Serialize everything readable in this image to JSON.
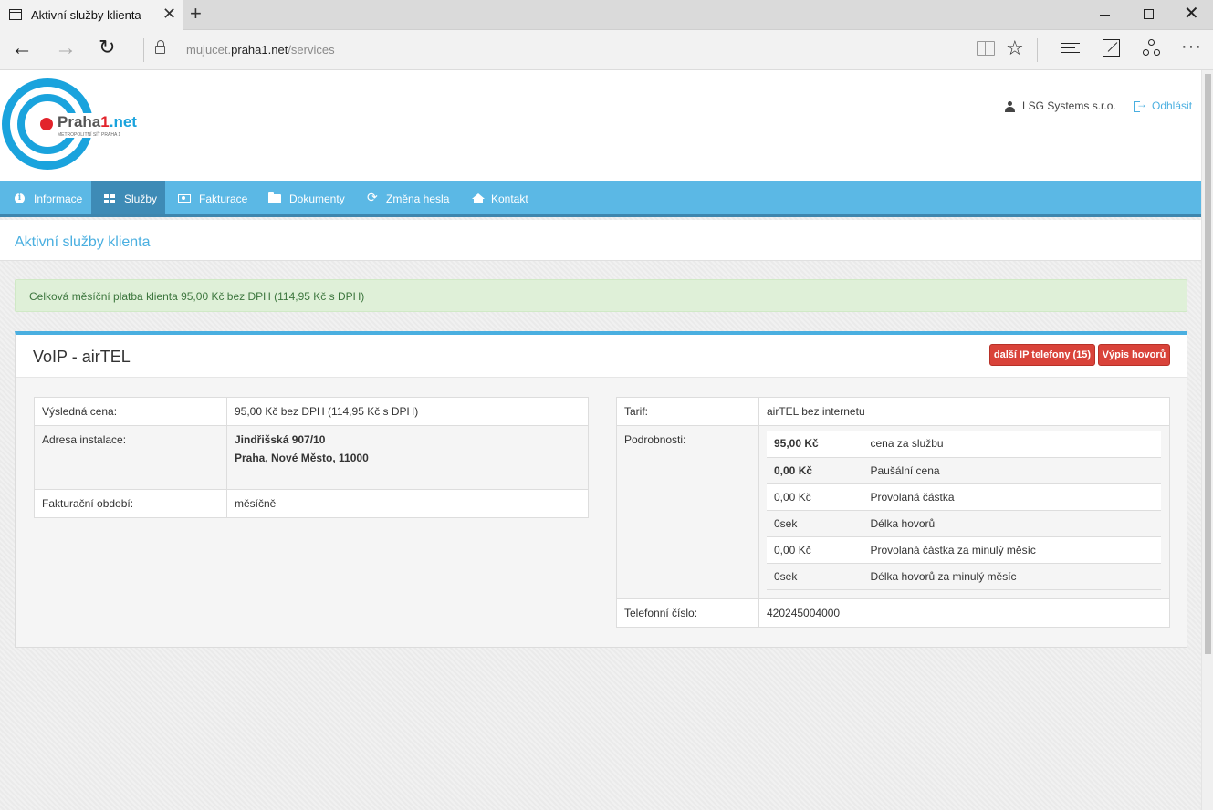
{
  "browser": {
    "tab_title": "Aktivní služby klienta",
    "url_prefix": "mujucet.",
    "url_domain": "praha1.net",
    "url_path": "/services"
  },
  "header": {
    "logo_text_a": "Praha",
    "logo_text_b": "1",
    "logo_text_c": ".net",
    "logo_subtitle": "METROPOLITNÍ SÍŤ PRAHA 1",
    "user_name": "LSG Systems s.r.o.",
    "logout_label": "Odhlásit"
  },
  "nav": {
    "items": [
      {
        "label": "Informace",
        "icon": "info-icon"
      },
      {
        "label": "Služby",
        "icon": "grid-icon",
        "active": true
      },
      {
        "label": "Fakturace",
        "icon": "money-icon"
      },
      {
        "label": "Dokumenty",
        "icon": "folder-icon"
      },
      {
        "label": "Změna hesla",
        "icon": "refresh-icon"
      },
      {
        "label": "Kontakt",
        "icon": "home-icon"
      }
    ]
  },
  "page": {
    "title": "Aktivní služby klienta",
    "alert": "Celková měsíční platba klienta 95,00 Kč bez DPH (114,95 Kč s DPH)"
  },
  "service": {
    "title": "VoIP - airTEL",
    "btn_phones": "další IP telefony (15)",
    "btn_calls": "Výpis hovorů",
    "left": {
      "price_label": "Výsledná cena:",
      "price_value": "95,00 Kč bez DPH (114,95 Kč s DPH)",
      "address_label": "Adresa instalace:",
      "address_line1": "Jindřišská 907/10",
      "address_line2": "Praha, Nové Město, 11000",
      "period_label": "Fakturační období:",
      "period_value": "měsíčně"
    },
    "right": {
      "tariff_label": "Tarif:",
      "tariff_value": "airTEL bez internetu",
      "details_label": "Podrobnosti:",
      "details": [
        {
          "value": "95,00 Kč",
          "name": "cena za službu"
        },
        {
          "value": "0,00 Kč",
          "name": "Paušální cena"
        },
        {
          "value": "0,00 Kč",
          "name": "Provolaná částka"
        },
        {
          "value": "0sek",
          "name": "Délka hovorů"
        },
        {
          "value": "0,00 Kč",
          "name": "Provolaná částka za minulý měsíc"
        },
        {
          "value": "0sek",
          "name": "Délka hovorů za minulý měsíc"
        }
      ],
      "phone_label": "Telefonní číslo:",
      "phone_value": "420245004000"
    }
  },
  "colors": {
    "accent": "#4aafe0",
    "nav_bg": "#5bb8e5",
    "nav_active": "#3e8bb6",
    "alert_bg": "#dff0d8",
    "alert_text": "#3c763d",
    "button_red": "#d9433a"
  }
}
